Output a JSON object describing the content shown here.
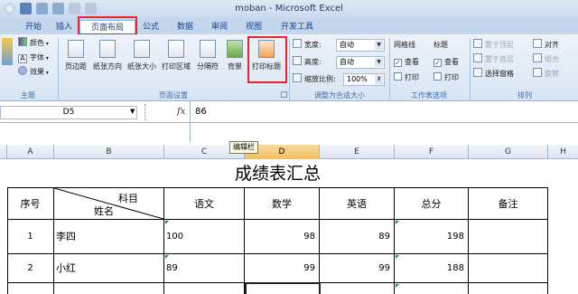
{
  "window": {
    "title": "moban - Microsoft Excel"
  },
  "tabs": [
    {
      "label": "开始",
      "active": false
    },
    {
      "label": "插入",
      "active": false
    },
    {
      "label": "页面布局",
      "active": true
    },
    {
      "label": "公式",
      "active": false
    },
    {
      "label": "数据",
      "active": false
    },
    {
      "label": "审阅",
      "active": false
    },
    {
      "label": "视图",
      "active": false
    },
    {
      "label": "开发工具",
      "active": false
    }
  ],
  "ribbon": {
    "theme": {
      "items": [
        "颜色",
        "字体",
        "效果"
      ],
      "group_label": "主题"
    },
    "page_setup": {
      "buttons": [
        "页边距",
        "纸张方向",
        "纸张大小",
        "打印区域",
        "分隔符",
        "背景",
        "打印标题"
      ],
      "group_label": "页面设置"
    },
    "scale": {
      "width_label": "宽度:",
      "width_value": "自动",
      "height_label": "高度:",
      "height_value": "自动",
      "scale_label": "缩放比例:",
      "scale_value": "100%",
      "group_label": "调整为合适大小"
    },
    "sheet_options": {
      "gridlines": "网格线",
      "headings": "标题",
      "view": "查看",
      "print": "打印",
      "group_label": "工作表选项"
    },
    "arrange": {
      "items": [
        "置于顶层",
        "置于底层",
        "选择窗格",
        "对齐",
        "组合",
        "旋转"
      ],
      "group_label": "排列"
    }
  },
  "formula": {
    "name_box": "D5",
    "fx": "fx",
    "value": "86",
    "tooltip": "编辑栏"
  },
  "columns": [
    "A",
    "B",
    "C",
    "D",
    "E",
    "F",
    "G",
    "H"
  ],
  "selected_column": "D",
  "sheet": {
    "title": "成绩表汇总",
    "diag_top": "科目",
    "diag_bottom": "姓名",
    "headers": [
      "序号",
      "语文",
      "数学",
      "英语",
      "总分",
      "备注"
    ],
    "rows": [
      {
        "no": "1",
        "name": "李四",
        "chinese": "100",
        "math": "98",
        "english": "89",
        "total": "198",
        "note": ""
      },
      {
        "no": "2",
        "name": "小红",
        "chinese": "89",
        "math": "99",
        "english": "99",
        "total": "188",
        "note": ""
      }
    ]
  }
}
